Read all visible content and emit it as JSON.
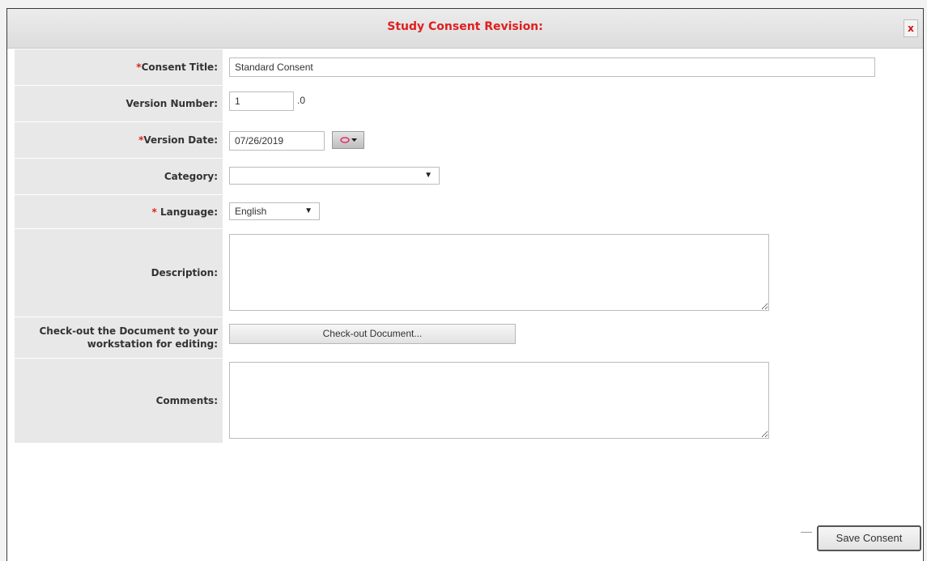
{
  "dialog": {
    "title": "Study Consent Revision:",
    "close_label": "x"
  },
  "form": {
    "consent_title": {
      "required": "*",
      "label": "Consent Title:",
      "value": "Standard Consent"
    },
    "version_number": {
      "label": "Version Number:",
      "value": "1",
      "suffix": ".0"
    },
    "version_date": {
      "required": "*",
      "label": "Version Date:",
      "value": "07/26/2019"
    },
    "category": {
      "label": "Category:",
      "value": ""
    },
    "language": {
      "required": "* ",
      "label": "Language:",
      "value": "English"
    },
    "description": {
      "label": "Description:",
      "value": ""
    },
    "checkout": {
      "label": "Check-out the Document to your workstation for editing:",
      "button_label": "Check-out Document..."
    },
    "comments": {
      "label": "Comments:",
      "value": ""
    }
  },
  "footer": {
    "save_label": "Save Consent"
  },
  "icons": {
    "calendar": "calendar-icon",
    "dropdown": "chevron-down-icon"
  },
  "colors": {
    "required": "#e01e1e",
    "title": "#e01e1e"
  }
}
